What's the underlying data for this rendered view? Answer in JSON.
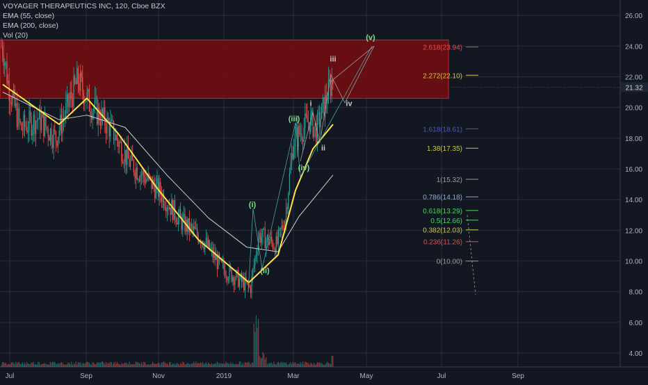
{
  "legend": {
    "title": "VOYAGER THERAPEUTICS INC, 120, Cboe BZX",
    "ema55": "EMA (55, close)",
    "ema200": "EMA (200, close)",
    "vol": "Vol (20)"
  },
  "colors": {
    "background": "#131722",
    "grid": "#2a2e39",
    "axis_text": "#b2b5be",
    "resistance_zone": "#7a0c10",
    "ema55": "#ffe24a",
    "ema200": "#cfcfcf",
    "candle_up": "#26a69a",
    "candle_down": "#ef5350",
    "wave_green": "#7ee08a",
    "wave_gray": "#c9c9c9"
  },
  "chart_data": {
    "type": "candlestick",
    "x_tick_labels": [
      "Jul",
      "Sep",
      "Nov",
      "2019",
      "Mar",
      "May",
      "Jul",
      "Sep"
    ],
    "y_tick_labels": [
      "4.00",
      "6.00",
      "8.00",
      "10.00",
      "12.00",
      "14.00",
      "16.00",
      "18.00",
      "20.00",
      "22.00",
      "24.00",
      "26.00"
    ],
    "ylim": [
      3.1,
      27
    ],
    "grid": true,
    "last_price": "21.32",
    "price_path": [
      {
        "x": "Jul",
        "y": 24.0
      },
      {
        "x": "Jul",
        "y": 21.5
      },
      {
        "x": "Jul",
        "y": 18.6
      },
      {
        "x": "Aug",
        "y": 19.3
      },
      {
        "x": "Aug",
        "y": 18.0
      },
      {
        "x": "Sep",
        "y": 21.8
      },
      {
        "x": "Sep",
        "y": 20.3
      },
      {
        "x": "Oct",
        "y": 18.6
      },
      {
        "x": "Oct",
        "y": 16.5
      },
      {
        "x": "Nov",
        "y": 14.5
      },
      {
        "x": "Nov",
        "y": 12.5
      },
      {
        "x": "Dec",
        "y": 11.5
      },
      {
        "x": "Dec",
        "y": 9.6
      },
      {
        "x": "2019",
        "y": 8.9
      },
      {
        "x": "2019",
        "y": 8.2
      },
      {
        "x": "Jan",
        "y": 11.7
      },
      {
        "x": "Feb",
        "y": 11.0
      },
      {
        "x": "Feb",
        "y": 12.8
      },
      {
        "x": "Mar",
        "y": 17.8
      },
      {
        "x": "Mar",
        "y": 19.2
      },
      {
        "x": "Mar",
        "y": 18.5
      },
      {
        "x": "Apr",
        "y": 21.8
      }
    ],
    "ema55": [
      {
        "x": "Jul",
        "y": 21.5
      },
      {
        "x": "Aug",
        "y": 18.9
      },
      {
        "x": "Sep",
        "y": 20.6
      },
      {
        "x": "Oct",
        "y": 18.3
      },
      {
        "x": "Nov",
        "y": 14.8
      },
      {
        "x": "Dec",
        "y": 11.4
      },
      {
        "x": "2019",
        "y": 8.6
      },
      {
        "x": "Feb",
        "y": 10.4
      },
      {
        "x": "Mar",
        "y": 14.6
      },
      {
        "x": "Mar",
        "y": 17.3
      },
      {
        "x": "Apr",
        "y": 18.9
      }
    ],
    "ema200": [
      {
        "x": "Jul",
        "y": 21.0
      },
      {
        "x": "Aug",
        "y": 19.2
      },
      {
        "x": "Sep",
        "y": 19.5
      },
      {
        "x": "Oct",
        "y": 18.7
      },
      {
        "x": "Nov",
        "y": 15.6
      },
      {
        "x": "Dec",
        "y": 12.8
      },
      {
        "x": "2019",
        "y": 10.9
      },
      {
        "x": "Feb",
        "y": 10.6
      },
      {
        "x": "Mar",
        "y": 12.9
      },
      {
        "x": "Apr",
        "y": 15.6
      }
    ],
    "resistance_zone": {
      "from": 20.6,
      "to": 24.4
    },
    "fib_levels": [
      {
        "label": "2.618(23.94)",
        "value": 23.94,
        "color": "#e84a4a"
      },
      {
        "label": "2.272(22.10)",
        "value": 22.1,
        "color": "#d4c24a"
      },
      {
        "label": "1.618(18.61)",
        "value": 18.61,
        "color": "#4a55c8"
      },
      {
        "label": "1.38(17.35)",
        "value": 17.35,
        "color": "#c8c84a"
      },
      {
        "label": "1(15.32)",
        "value": 15.32,
        "color": "#9a9a9a"
      },
      {
        "label": "0.786(14.18)",
        "value": 14.18,
        "color": "#8fa8c8"
      },
      {
        "label": "0.618(13.29)",
        "value": 13.29,
        "color": "#4ad45a"
      },
      {
        "label": "0.5(12.66)",
        "value": 12.66,
        "color": "#4ad46a"
      },
      {
        "label": "0.382(12.03)",
        "value": 12.03,
        "color": "#c8c84a"
      },
      {
        "label": "0.236(11.26)",
        "value": 11.26,
        "color": "#e84a4a"
      },
      {
        "label": "0(10.00)",
        "value": 10.0,
        "color": "#9a9a9a"
      }
    ],
    "wave_labels": [
      {
        "text": "(i)",
        "y": 13.5,
        "color": "#7ee08a"
      },
      {
        "text": "(ii)",
        "y": 9.2,
        "color": "#7ee08a"
      },
      {
        "text": "(iii)",
        "y": 19.1,
        "color": "#7ee08a"
      },
      {
        "text": "(iv)",
        "y": 15.9,
        "color": "#7ee08a"
      },
      {
        "text": "i",
        "y": 20.1,
        "color": "#c9c9c9"
      },
      {
        "text": "ii",
        "y": 17.2,
        "color": "#c9c9c9"
      },
      {
        "text": "iii",
        "y": 23.0,
        "color": "#c9c9c9"
      },
      {
        "text": "iv",
        "y": 20.1,
        "color": "#c9c9c9"
      },
      {
        "text": "(v)",
        "y": 24.4,
        "color": "#7ee08a"
      }
    ]
  }
}
